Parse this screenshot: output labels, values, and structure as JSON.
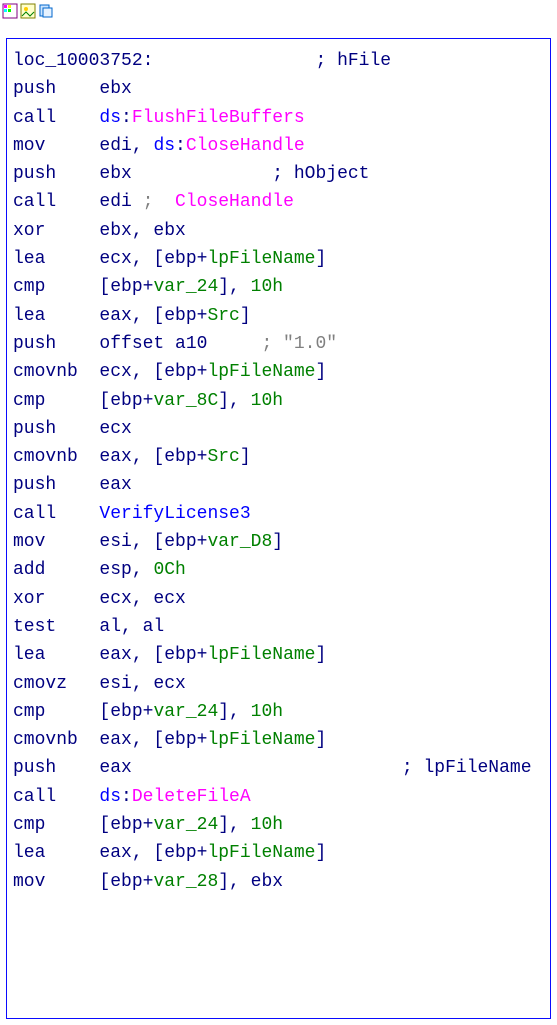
{
  "toolbar": {
    "icons": [
      "palette-icon",
      "photo-icon",
      "copy-icon"
    ]
  },
  "disasm": {
    "label": "loc_10003752:",
    "label_comment": "; hFile",
    "lines": [
      {
        "m": "push",
        "a": [
          "ebx"
        ]
      },
      {
        "m": "call",
        "ds": true,
        "api": "FlushFileBuffers"
      },
      {
        "m": "mov",
        "a": [
          "edi, "
        ],
        "ds": true,
        "api": "CloseHandle"
      },
      {
        "m": "push",
        "a": [
          "ebx"
        ],
        "comment": "; hObject",
        "cblue": true
      },
      {
        "m": "call",
        "a": [
          "edi "
        ],
        "raw_comment": "; ",
        "api": " CloseHandle"
      },
      {
        "m": "xor",
        "a": [
          "ebx, ebx"
        ]
      },
      {
        "m": "lea",
        "a": [
          "ecx, [ebp+"
        ],
        "var": "lpFileName",
        "a2": [
          "]"
        ]
      },
      {
        "m": "cmp",
        "a": [
          "[ebp+"
        ],
        "var": "var_24",
        "a2": [
          "], "
        ],
        "num": "10h"
      },
      {
        "m": "lea",
        "a": [
          "eax, [ebp+"
        ],
        "var": "Src",
        "a2": [
          "]"
        ]
      },
      {
        "m": "push",
        "a": [
          "offset a10     "
        ],
        "str": "; \"1.0\""
      },
      {
        "m": "cmovnb",
        "a": [
          "ecx, [ebp+"
        ],
        "var": "lpFileName",
        "a2": [
          "]"
        ]
      },
      {
        "m": "cmp",
        "a": [
          "[ebp+"
        ],
        "var": "var_8C",
        "a2": [
          "], "
        ],
        "num": "10h"
      },
      {
        "m": "push",
        "a": [
          "ecx"
        ]
      },
      {
        "m": "cmovnb",
        "a": [
          "eax, [ebp+"
        ],
        "var": "Src",
        "a2": [
          "]"
        ]
      },
      {
        "m": "push",
        "a": [
          "eax"
        ]
      },
      {
        "m": "call",
        "func": "VerifyLicense3"
      },
      {
        "m": "mov",
        "a": [
          "esi, [ebp+"
        ],
        "var": "var_D8",
        "a2": [
          "]"
        ]
      },
      {
        "m": "add",
        "a": [
          "esp, "
        ],
        "num": "0Ch"
      },
      {
        "m": "xor",
        "a": [
          "ecx, ecx"
        ]
      },
      {
        "m": "test",
        "a": [
          "al, al"
        ]
      },
      {
        "m": "lea",
        "a": [
          "eax, [ebp+"
        ],
        "var": "lpFileName",
        "a2": [
          "]"
        ]
      },
      {
        "m": "cmovz",
        "a": [
          "esi, ecx"
        ]
      },
      {
        "m": "cmp",
        "a": [
          "[ebp+"
        ],
        "var": "var_24",
        "a2": [
          "], "
        ],
        "num": "10h"
      },
      {
        "m": "cmovnb",
        "a": [
          "eax, [ebp+"
        ],
        "var": "lpFileName",
        "a2": [
          "]"
        ]
      },
      {
        "m": "push",
        "a": [
          "eax"
        ],
        "comment": "            ; lpFileName",
        "cblue": true
      },
      {
        "m": "call",
        "ds": true,
        "api": "DeleteFileA"
      },
      {
        "m": "cmp",
        "a": [
          "[ebp+"
        ],
        "var": "var_24",
        "a2": [
          "], "
        ],
        "num": "10h"
      },
      {
        "m": "lea",
        "a": [
          "eax, [ebp+"
        ],
        "var": "lpFileName",
        "a2": [
          "]"
        ]
      },
      {
        "m": "mov",
        "a": [
          "[ebp+"
        ],
        "var": "var_28",
        "a2": [
          "], ebx"
        ]
      }
    ]
  }
}
